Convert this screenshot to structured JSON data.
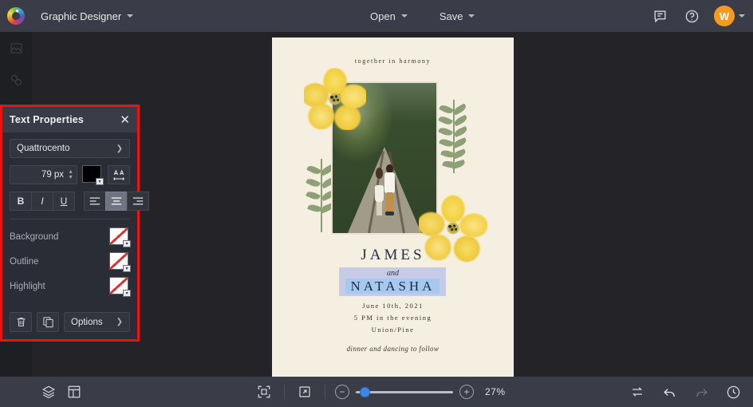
{
  "topbar": {
    "logo_icon": "color-wheel-logo-icon",
    "app_title": "Graphic Designer",
    "open_label": "Open",
    "save_label": "Save",
    "comment_icon": "comment-icon",
    "help_icon": "help-circle-icon",
    "avatar_initial": "W"
  },
  "left_rail": {
    "items": [
      {
        "icon": "image-icon"
      },
      {
        "icon": "shapes-icon"
      },
      {
        "icon": "text-icon"
      }
    ]
  },
  "panel": {
    "title": "Text Properties",
    "close_icon": "close-icon",
    "font_family": "Quattrocento",
    "font_family_chevron": "chevron-right-icon",
    "font_size": "79 px",
    "text_color": "#000000",
    "letter_spacing_icon": "letter-spacing-icon",
    "bold_label": "B",
    "italic_label": "I",
    "underline_label": "U",
    "align_left_icon": "align-left-icon",
    "align_center_icon": "align-center-icon",
    "align_right_icon": "align-right-icon",
    "active_align": "center",
    "props": [
      {
        "label": "Background",
        "value": "none"
      },
      {
        "label": "Outline",
        "value": "none"
      },
      {
        "label": "Highlight",
        "value": "none"
      }
    ],
    "delete_icon": "trash-icon",
    "duplicate_icon": "duplicate-icon",
    "options_label": "Options",
    "options_chevron": "chevron-right-icon",
    "highlight_border_color": "#ee1111"
  },
  "canvas": {
    "card": {
      "background_color": "#f4efe0",
      "tagline": "together in harmony",
      "photo_alt": "couple embracing on railroad tracks surrounded by trees",
      "name_primary": "JAMES",
      "name_conjunction": "and",
      "name_secondary": "NATASHA",
      "detail_date": "June 10th, 2021",
      "detail_time": "5 PM in the evening",
      "detail_venue": "Union/Pine",
      "footer": "dinner and dancing to follow",
      "selection_color": "#c7cbe6",
      "highlight_color": "#a6c9f0"
    }
  },
  "bottombar": {
    "layers_icon": "layers-icon",
    "pages_icon": "pages-layout-icon",
    "fit_icon": "fit-to-screen-icon",
    "fullscreen_icon": "expand-arrow-icon",
    "zoom_out_label": "−",
    "zoom_in_label": "+",
    "zoom_value": "27%",
    "zoom_slider_percent": 9,
    "swap_icon": "swap-arrows-icon",
    "undo_icon": "undo-arrow-icon",
    "redo_icon": "redo-arrow-icon",
    "history_icon": "history-clock-icon"
  }
}
